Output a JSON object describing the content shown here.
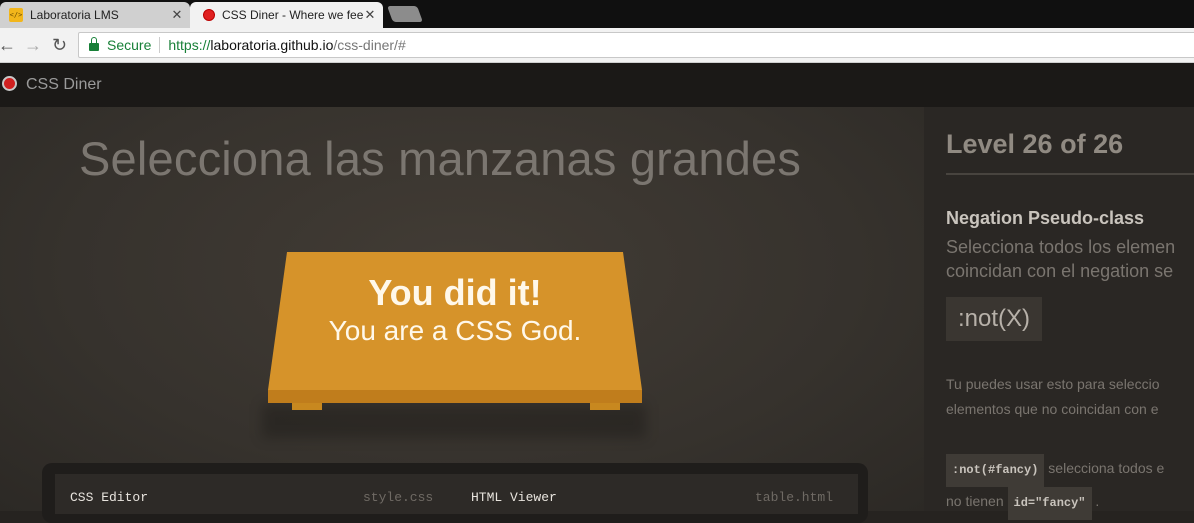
{
  "browser": {
    "tabs": [
      {
        "title": "Laboratoria LMS",
        "favicon": "laboratoria-icon"
      },
      {
        "title": "CSS Diner - Where we feed on CSS",
        "favicon": "css-diner-icon"
      }
    ],
    "close_glyph": "✕",
    "secure_label": "Secure",
    "url": {
      "scheme": "https://",
      "host": "laboratoria.github.io",
      "path": "/css-diner/#"
    }
  },
  "app": {
    "title": "CSS Diner",
    "instruction": "Selecciona las manzanas grandes",
    "success_title": "You did it!",
    "success_subtitle": "You are a CSS God.",
    "editor": {
      "css_label": "CSS Editor",
      "css_file": "style.css",
      "html_label": "HTML Viewer",
      "html_file": "table.html"
    },
    "colors": {
      "table": "#d6932a",
      "accent_dot": "#d02020"
    }
  },
  "sidebar": {
    "level_text": "Level 26 of 26",
    "selector_name": "Negation Pseudo-class",
    "description_line1": "Selecciona todos los elemen",
    "description_line2": "coincidan con el negation se",
    "syntax": ":not(X)",
    "hint_line1": "Tu puedes usar esto para seleccio",
    "hint_line2": "elementos que no coincidan con e",
    "example_code": ":not(#fancy)",
    "example_text1": " selecciona todos e",
    "example_text2": "no tienen ",
    "example_code2": "id=\"fancy\"",
    "example_text3": " ."
  }
}
